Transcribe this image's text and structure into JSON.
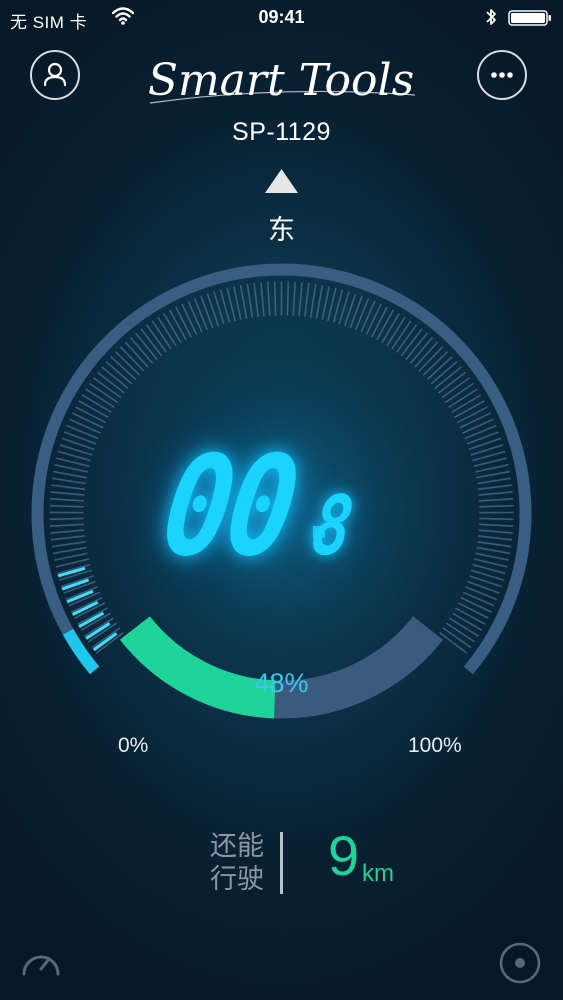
{
  "status_bar": {
    "carrier": "无 SIM 卡",
    "time": "09:41"
  },
  "header": {
    "logo_text": "Smart Tools",
    "device_id": "SP-1129",
    "left_icon": "user-icon",
    "right_icon": "more-icon"
  },
  "compass": {
    "direction": "东"
  },
  "gauge": {
    "speed_integer": "00",
    "speed_decimal": "8",
    "battery_percent_text": "48%",
    "battery_level": 0.48,
    "min_label": "0%",
    "max_label": "100%"
  },
  "range": {
    "label_line1": "还能",
    "label_line2": "行驶",
    "value": "9",
    "unit": "km"
  },
  "bottom_bar": {
    "left_icon": "speedometer-icon",
    "right_icon": "locate-icon"
  },
  "colors": {
    "accent_cyan": "#1ad3ff",
    "battery_green": "#1fd49a",
    "ring": "#33557a",
    "background": "#082133"
  }
}
